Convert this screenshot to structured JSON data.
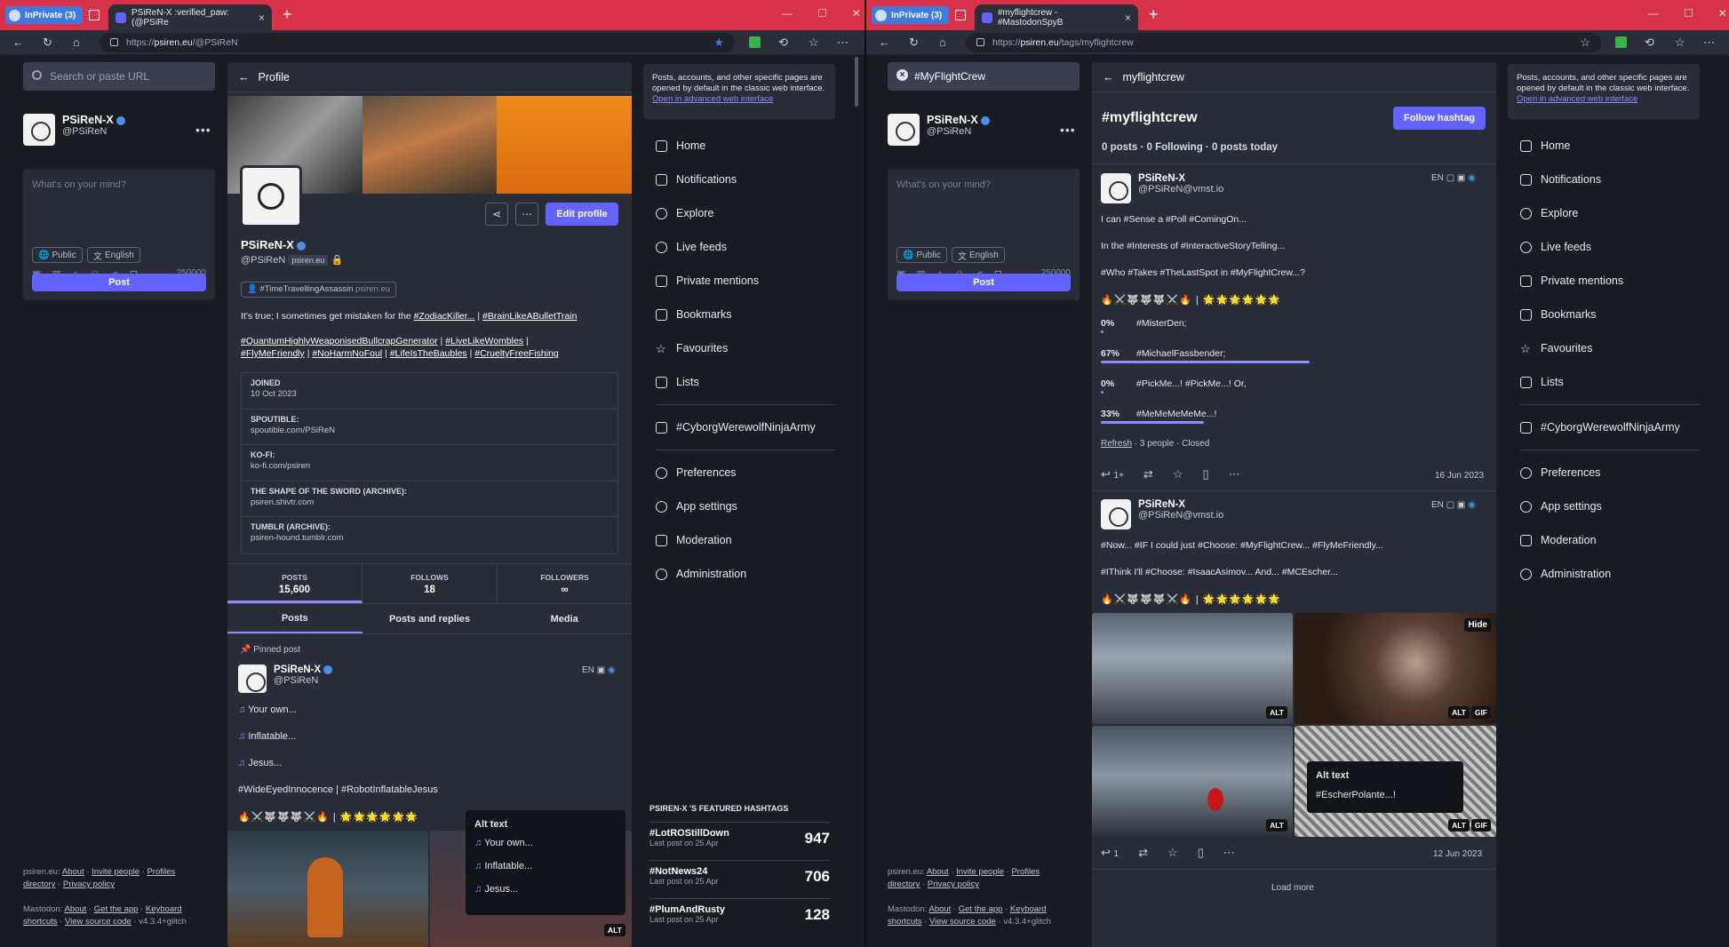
{
  "left": {
    "tabs": {
      "inprivate": "InPrivate (3)",
      "active_title": "PSiReN-X :verified_paw: (@PSiRe"
    },
    "url_prefix": "https://",
    "url_host": "psiren.eu",
    "url_path": "/@PSiReN",
    "search_placeholder": "Search or paste URL",
    "me": {
      "name": "PSiReN-X",
      "handle": "@PSiReN"
    },
    "composer": {
      "placeholder": "What's on your mind?",
      "visibility": "Public",
      "language": "English",
      "count": "250000",
      "post": "Post"
    },
    "footer": {
      "l1a": "psiren.eu:",
      "about": "About",
      "invite": "Invite people",
      "profiles": "Profiles",
      "l2a": "directory",
      "privacy": "Privacy policy",
      "mastodon": "Mastodon:",
      "about2": "About",
      "getapp": "Get the app",
      "keyboard": "Keyboard",
      "shortcuts": "shortcuts",
      "source": "View source code",
      "version": "v4.3.4+glitch"
    },
    "profile": {
      "header": "Profile",
      "name": "PSiReN-X",
      "handle": "@PSiReN",
      "domain": "psiren.eu",
      "edit": "Edit profile",
      "tag_pill": "#TimeTravellingAssassin",
      "tag_pill_domain": "psiren.eu",
      "bio1a": "It's true; I sometimes get mistaken for the ",
      "bio1b": "#ZodiacKiller...",
      "bio1c": " | ",
      "bio1d": "#BrainLikeABulletTrain",
      "bio2a": "#QuantumHighlyWeaponisedBullcrapGenerator",
      "bio2b": " | ",
      "bio2c": "#LiveLikeWombles",
      "bio2d": " |",
      "bio3a": "#FlyMeFriendly",
      "bio3b": " | ",
      "bio3c": "#NoHarmNoFoul",
      "bio3d": " | ",
      "bio3e": "#LifeIsTheBaubles",
      "bio3f": " | ",
      "bio3g": "#CrueltyFreeFishing",
      "fields": [
        {
          "k": "JOINED",
          "v": "10 Oct 2023"
        },
        {
          "k": "SPOUTIBLE:",
          "v": "spoutible.com/PSiReN"
        },
        {
          "k": "KO-FI:",
          "v": "ko-fi.com/psiren"
        },
        {
          "k": "THE SHAPE OF THE SWORD (ARCHIVE):",
          "v": "psiren.shivtr.com"
        },
        {
          "k": "TUMBLR (ARCHIVE):",
          "v": "psiren-hound.tumblr.com"
        }
      ],
      "stats": [
        {
          "label": "POSTS",
          "value": "15,600"
        },
        {
          "label": "FOLLOWS",
          "value": "18"
        },
        {
          "label": "FOLLOWERS",
          "value": "∞"
        }
      ],
      "subtabs": [
        "Posts",
        "Posts and replies",
        "Media"
      ],
      "pinned": "Pinned post",
      "post": {
        "name": "PSiReN-X",
        "handle": "@PSiReN",
        "lang": "EN",
        "l1": "Your own...",
        "l2": "Inflatable...",
        "l3": "Jesus...",
        "tags": "#WideEyedInnocence | #RobotInflatableJesus",
        "emoji": "🔥⚔️🐺🐺🐺⚔️🔥 | 🌟🌟🌟🌟🌟🌟"
      },
      "alt": {
        "title": "Alt text",
        "l1": "Your own...",
        "l2": "Inflatable...",
        "l3": "Jesus...",
        "badge": "ALT"
      }
    },
    "notice": {
      "text": "Posts, accounts, and other specific pages are opened by default in the classic web interface. ",
      "link": "Open in advanced web interface"
    },
    "nav": [
      "Home",
      "Notifications",
      "Explore",
      "Live feeds",
      "Private mentions",
      "Bookmarks",
      "Favourites",
      "Lists"
    ],
    "nav_list": "#CyborgWerewolfNinjaArmy",
    "nav2": [
      "Preferences",
      "App settings",
      "Moderation",
      "Administration"
    ],
    "featured": {
      "title": "PSIREN-X 'S FEATURED HASHTAGS",
      "items": [
        {
          "tag": "#LotROStillDown",
          "sub": "Last post on 25 Apr",
          "num": "947"
        },
        {
          "tag": "#NotNews24",
          "sub": "Last post on 25 Apr",
          "num": "706"
        },
        {
          "tag": "#PlumAndRusty",
          "sub": "Last post on 25 Apr",
          "num": "128"
        }
      ]
    }
  },
  "right": {
    "tabs": {
      "inprivate": "InPrivate (3)",
      "active_title": "#myflightcrew - #MastodonSpyB"
    },
    "url_prefix": "https://",
    "url_host": "psiren.eu",
    "url_path": "/tags/myflightcrew",
    "search_value": "#MyFlightCrew",
    "me": {
      "name": "PSiReN-X",
      "handle": "@PSiReN"
    },
    "composer": {
      "placeholder": "What's on your mind?",
      "visibility": "Public",
      "language": "English",
      "count": "250000",
      "post": "Post"
    },
    "footer": {
      "l1a": "psiren.eu:",
      "about": "About",
      "invite": "Invite people",
      "profiles": "Profiles",
      "l2a": "directory",
      "privacy": "Privacy policy",
      "mastodon": "Mastodon:",
      "about2": "About",
      "getapp": "Get the app",
      "keyboard": "Keyboard",
      "shortcuts": "shortcuts",
      "source": "View source code",
      "version": "v4.3.4+glitch"
    },
    "tag": {
      "header": "myflightcrew",
      "title": "#myflightcrew",
      "follow": "Follow hashtag",
      "stats": "0 posts · 0 Following · 0 posts today"
    },
    "post1": {
      "name": "PSiReN-X",
      "handle": "@PSiReN@vmst.io",
      "lang": "EN",
      "l1": "I can #Sense a #Poll #ComingOn...",
      "l2": "In the #Interests of #InteractiveStoryTelling...",
      "l3": "#Who #Takes #TheLastSpot in #MyFlightCrew...?",
      "emoji": "🔥⚔️🐺🐺🐺⚔️🔥 | 🌟🌟🌟🌟🌟🌟",
      "poll": [
        {
          "pct": "0%",
          "label": "#MisterDen;",
          "value": 0
        },
        {
          "pct": "67%",
          "label": "#MichaelFassbender;",
          "value": 67
        },
        {
          "pct": "0%",
          "label": "#PickMe...! #PickMe...! Or,",
          "value": 0
        },
        {
          "pct": "33%",
          "label": "#MeMeMeMeMe...!",
          "value": 33
        }
      ],
      "refresh": "Refresh",
      "poll_meta": " · 3 people · Closed",
      "replies": "1+",
      "date": "16 Jun 2023"
    },
    "post2": {
      "name": "PSiReN-X",
      "handle": "@PSiReN@vmst.io",
      "lang": "EN",
      "l1": "#Now... #IF I could just #Choose: #MyFlightCrew... #FlyMeFriendly...",
      "l2": "#IThink I'll #Choose: #IsaacAsimov... And... #MCEscher...",
      "emoji": "🔥⚔️🐺🐺🐺⚔️🔥 | 🌟🌟🌟🌟🌟🌟",
      "hide": "Hide",
      "alt": "ALT",
      "gif": "GIF",
      "alt_title": "Alt text",
      "alt_text": "#EscherPolante...!",
      "replies": "1",
      "date": "12 Jun 2023"
    },
    "loadmore": "Load more",
    "notice": {
      "text": "Posts, accounts, and other specific pages are opened by default in the classic web interface. ",
      "link": "Open in advanced web interface"
    },
    "nav": [
      "Home",
      "Notifications",
      "Explore",
      "Live feeds",
      "Private mentions",
      "Bookmarks",
      "Favourites",
      "Lists"
    ],
    "nav_list": "#CyborgWerewolfNinjaArmy",
    "nav2": [
      "Preferences",
      "App settings",
      "Moderation",
      "Administration"
    ]
  },
  "colors": {
    "accent": "#6364ff",
    "tabstrip": "#d8324a",
    "bg": "#191b22",
    "panel": "#282c37"
  }
}
